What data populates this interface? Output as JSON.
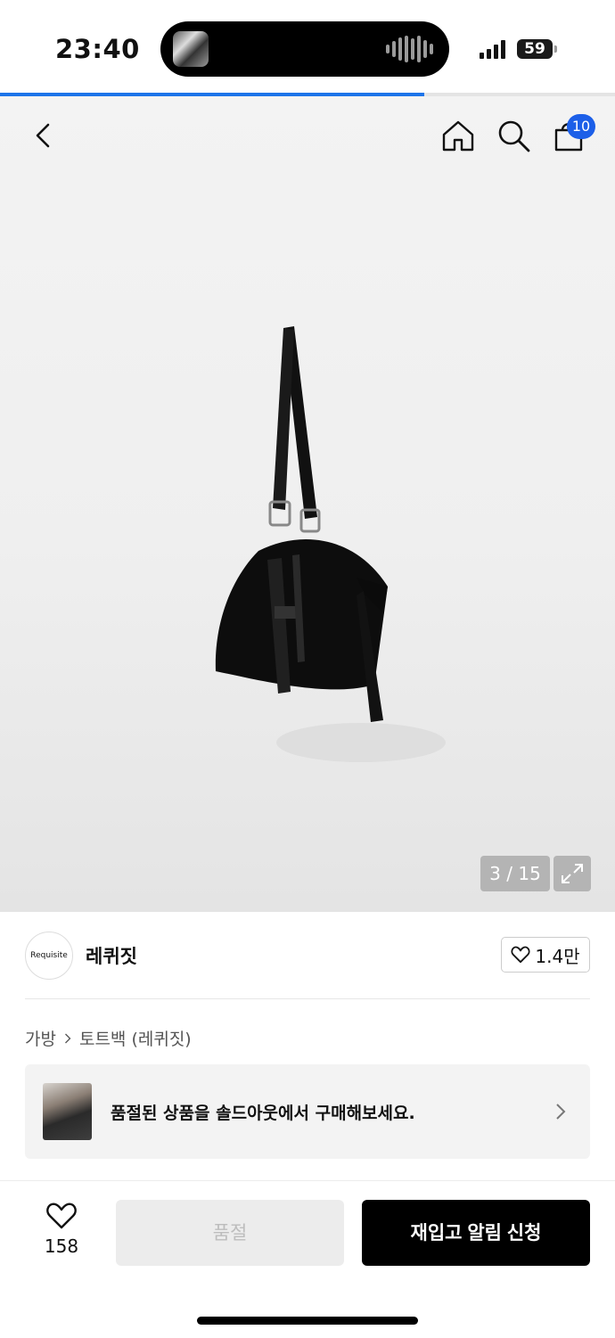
{
  "status_bar": {
    "time": "23:40",
    "battery": "59",
    "page_load_progress": 0.69
  },
  "header": {
    "back_icon": "chevron-left-icon",
    "home_icon": "home-icon",
    "search_icon": "search-icon",
    "cart_icon": "shopping-bag-icon",
    "cart_count": "10"
  },
  "gallery": {
    "counter": "3 / 15",
    "expand_icon": "expand-icon"
  },
  "brand": {
    "logo_text": "Requisite",
    "name": "레퀴짓",
    "likes": "1.4만"
  },
  "breadcrumb": {
    "items": [
      "가방",
      "토트백 (레퀴짓)"
    ]
  },
  "soldout_banner": {
    "text": "품절된 상품을 솔드아웃에서 구매해보세요."
  },
  "bottom_bar": {
    "wish_count": "158",
    "soldout_label": "품절",
    "restock_label": "재입고 알림 신청"
  },
  "colors": {
    "accent": "#1c74e9",
    "badge": "#1c5fe8",
    "primary_button": "#000000",
    "disabled_button": "#ececec"
  }
}
